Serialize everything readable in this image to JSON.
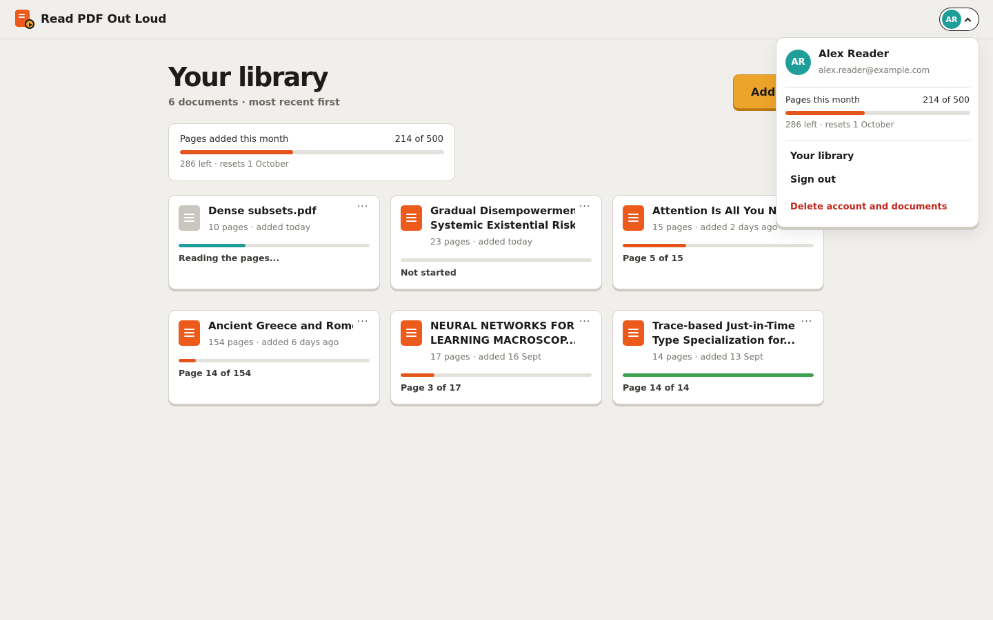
{
  "app": {
    "name": "Read PDF Out Loud"
  },
  "account_button": {
    "initials": "AR"
  },
  "library": {
    "title": "Your library",
    "subtitle": "6 documents · most recent first",
    "add_button": "Add PDF"
  },
  "quota": {
    "label": "Pages added this month",
    "count": "214 of 500",
    "used": 214,
    "limit": 500,
    "note": "286 left · resets 1 October",
    "color": "#e4541a"
  },
  "documents": [
    {
      "title": "Dense subsets.pdf",
      "title_lines": [
        "Dense subsets.pdf"
      ],
      "meta": "10 pages · added today",
      "progress": 0.35,
      "bar_color": "#1f9e99",
      "status": "Reading the pages...",
      "icon": "document-icon",
      "icon_state": "processing"
    },
    {
      "title": "Gradual Disempowerment: Systemic Existential Risk...",
      "title_lines": [
        "Gradual Disempowerment:",
        "Systemic Existential Risk..."
      ],
      "meta": "23 pages · added today",
      "progress": 0,
      "bar_color": "#e4541a",
      "status": "Not started",
      "icon": "document-icon",
      "icon_state": "ready"
    },
    {
      "title": "Attention Is All You Need",
      "title_lines": [
        "Attention Is All You Need"
      ],
      "meta": "15 pages · added 2 days ago",
      "progress": 0.3333,
      "bar_color": "#e4541a",
      "status": "Page 5 of 15",
      "icon": "document-icon",
      "icon_state": "ready"
    },
    {
      "title": "Ancient Greece and Rome",
      "title_lines": [
        "Ancient Greece and Rome"
      ],
      "meta": "154 pages · added 6 days ago",
      "progress": 0.0909,
      "bar_color": "#e4541a",
      "status": "Page 14 of 154",
      "icon": "document-icon",
      "icon_state": "ready"
    },
    {
      "title": "NEURAL NETWORKS FOR LEARNING MACROSCOP...",
      "title_lines": [
        "NEURAL NETWORKS FOR",
        "LEARNING MACROSCOP..."
      ],
      "meta": "17 pages · added 16 Sept",
      "progress": 0.1765,
      "bar_color": "#e4541a",
      "status": "Page 3 of 17",
      "icon": "document-icon",
      "icon_state": "ready"
    },
    {
      "title": "Trace-based Just-in-Time Type Specialization for...",
      "title_lines": [
        "Trace-based Just-in-Time",
        "Type Specialization for..."
      ],
      "meta": "14 pages · added 13 Sept",
      "progress": 1,
      "bar_color": "#3a9f4f",
      "status": "Page 14 of 14",
      "icon": "document-icon",
      "icon_state": "ready"
    }
  ],
  "card_menu_glyph": "···",
  "account_menu": {
    "initials": "AR",
    "name": "Alex Reader",
    "email": "alex.reader@example.com",
    "quota_label": "Pages this month",
    "quota_count": "214 of 500",
    "quota_note": "286 left · resets 1 October",
    "items": [
      "Your library",
      "Sign out"
    ],
    "danger_item": "Delete account and documents",
    "danger_color": "#c0271c"
  }
}
